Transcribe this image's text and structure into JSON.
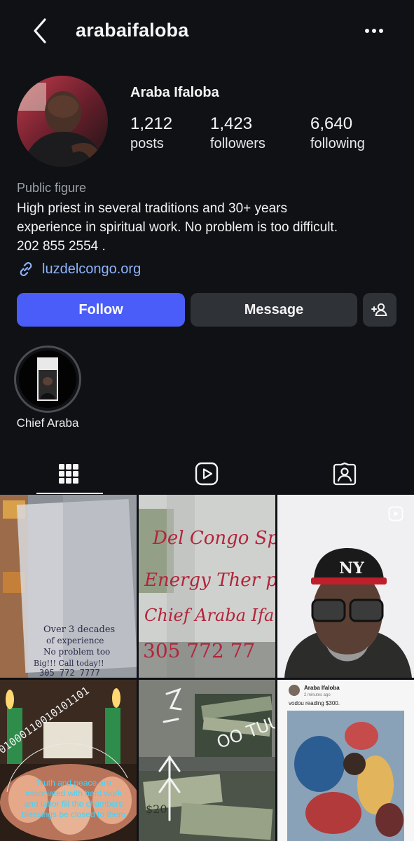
{
  "header": {
    "username": "arabaifaloba"
  },
  "profile": {
    "display_name": "Araba Ifaloba",
    "stats": [
      {
        "value": "1,212",
        "label": "posts"
      },
      {
        "value": "1,423",
        "label": "followers"
      },
      {
        "value": "6,640",
        "label": "following"
      }
    ],
    "category": "Public figure",
    "bio_lines": [
      "High priest in several traditions and 30+ years",
      "experience in spiritual work. No problem is too difficult.",
      "202 855 2554 ."
    ],
    "link": "luzdelcongo.org"
  },
  "actions": {
    "follow": "Follow",
    "message": "Message"
  },
  "highlights": [
    {
      "label": "Chief Araba"
    }
  ],
  "tabs": [
    {
      "icon": "grid-icon",
      "active": true
    },
    {
      "icon": "reels-icon",
      "active": false
    },
    {
      "icon": "tagged-icon",
      "active": false
    }
  ],
  "posts": {
    "p1": {
      "lines": [
        "Over 3 decades",
        "of experience",
        "No problem too",
        "Big!!! Call today!!",
        "305 772 7777"
      ]
    },
    "p2": {
      "lines": [
        "Del Congo Spi",
        "Energy Ther p",
        "Chief Araba Ifa",
        "305 772 77"
      ]
    },
    "p3": {
      "cap_text": "NY"
    },
    "p4": {
      "text": "Truth and peace are associated with hard work and labor fill the chambers blessings be closed to them",
      "binary": "01000110010101101"
    },
    "p5": {
      "text": "OO TUU"
    },
    "p6": {
      "name": "Araba Ifaloba",
      "time": "2 minutes ago",
      "caption": "vodou reading $300."
    }
  },
  "colors": {
    "accent": "#4a5df9",
    "link": "#8fb4ff",
    "background": "#0f1115",
    "button": "#2f3237"
  }
}
